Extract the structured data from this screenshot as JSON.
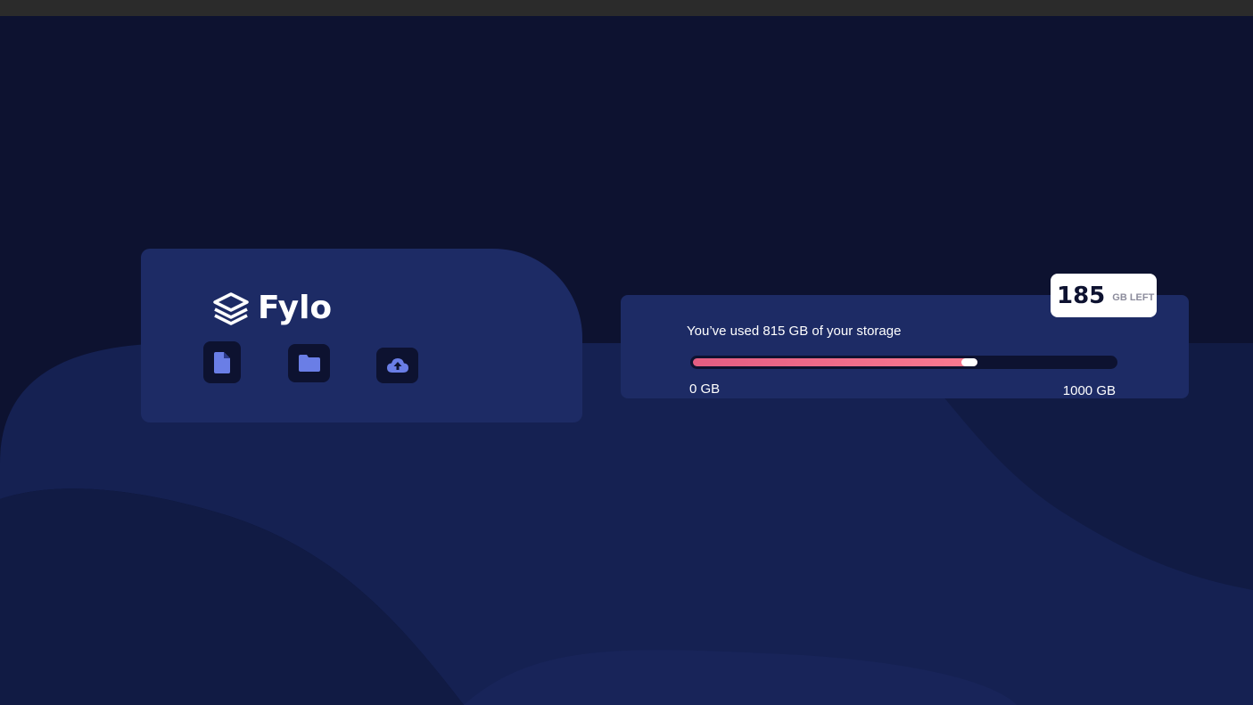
{
  "app": {
    "brand_name": "Fylo"
  },
  "toolbar": {
    "icons": [
      "document-icon",
      "folder-icon",
      "cloud-upload-icon"
    ]
  },
  "storage": {
    "usage_text": "You’ve used 815 GB of your storage",
    "used_gb": 815,
    "total_gb": 1000,
    "fill_fraction": 0.675,
    "scale_min_label": "0 GB",
    "scale_max_label": "1000 GB",
    "remaining_number": "185",
    "remaining_unit": "GB LEFT"
  },
  "colors": {
    "background": "#0d1230",
    "card": "#1d2b65",
    "accent_start": "#e35d82",
    "accent_end": "#fa7a90",
    "icon": "#6a7ee6"
  }
}
